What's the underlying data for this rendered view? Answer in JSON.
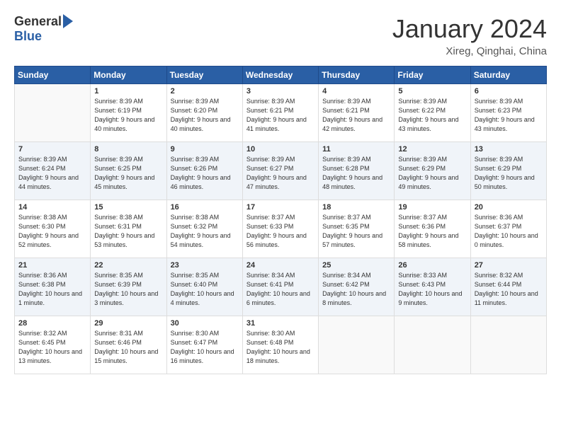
{
  "logo": {
    "general": "General",
    "blue": "Blue"
  },
  "title": "January 2024",
  "subtitle": "Xireg, Qinghai, China",
  "headers": [
    "Sunday",
    "Monday",
    "Tuesday",
    "Wednesday",
    "Thursday",
    "Friday",
    "Saturday"
  ],
  "weeks": [
    [
      {
        "num": "",
        "sunrise": "",
        "sunset": "",
        "daylight": ""
      },
      {
        "num": "1",
        "sunrise": "Sunrise: 8:39 AM",
        "sunset": "Sunset: 6:19 PM",
        "daylight": "Daylight: 9 hours and 40 minutes."
      },
      {
        "num": "2",
        "sunrise": "Sunrise: 8:39 AM",
        "sunset": "Sunset: 6:20 PM",
        "daylight": "Daylight: 9 hours and 40 minutes."
      },
      {
        "num": "3",
        "sunrise": "Sunrise: 8:39 AM",
        "sunset": "Sunset: 6:21 PM",
        "daylight": "Daylight: 9 hours and 41 minutes."
      },
      {
        "num": "4",
        "sunrise": "Sunrise: 8:39 AM",
        "sunset": "Sunset: 6:21 PM",
        "daylight": "Daylight: 9 hours and 42 minutes."
      },
      {
        "num": "5",
        "sunrise": "Sunrise: 8:39 AM",
        "sunset": "Sunset: 6:22 PM",
        "daylight": "Daylight: 9 hours and 43 minutes."
      },
      {
        "num": "6",
        "sunrise": "Sunrise: 8:39 AM",
        "sunset": "Sunset: 6:23 PM",
        "daylight": "Daylight: 9 hours and 43 minutes."
      }
    ],
    [
      {
        "num": "7",
        "sunrise": "Sunrise: 8:39 AM",
        "sunset": "Sunset: 6:24 PM",
        "daylight": "Daylight: 9 hours and 44 minutes."
      },
      {
        "num": "8",
        "sunrise": "Sunrise: 8:39 AM",
        "sunset": "Sunset: 6:25 PM",
        "daylight": "Daylight: 9 hours and 45 minutes."
      },
      {
        "num": "9",
        "sunrise": "Sunrise: 8:39 AM",
        "sunset": "Sunset: 6:26 PM",
        "daylight": "Daylight: 9 hours and 46 minutes."
      },
      {
        "num": "10",
        "sunrise": "Sunrise: 8:39 AM",
        "sunset": "Sunset: 6:27 PM",
        "daylight": "Daylight: 9 hours and 47 minutes."
      },
      {
        "num": "11",
        "sunrise": "Sunrise: 8:39 AM",
        "sunset": "Sunset: 6:28 PM",
        "daylight": "Daylight: 9 hours and 48 minutes."
      },
      {
        "num": "12",
        "sunrise": "Sunrise: 8:39 AM",
        "sunset": "Sunset: 6:29 PM",
        "daylight": "Daylight: 9 hours and 49 minutes."
      },
      {
        "num": "13",
        "sunrise": "Sunrise: 8:39 AM",
        "sunset": "Sunset: 6:29 PM",
        "daylight": "Daylight: 9 hours and 50 minutes."
      }
    ],
    [
      {
        "num": "14",
        "sunrise": "Sunrise: 8:38 AM",
        "sunset": "Sunset: 6:30 PM",
        "daylight": "Daylight: 9 hours and 52 minutes."
      },
      {
        "num": "15",
        "sunrise": "Sunrise: 8:38 AM",
        "sunset": "Sunset: 6:31 PM",
        "daylight": "Daylight: 9 hours and 53 minutes."
      },
      {
        "num": "16",
        "sunrise": "Sunrise: 8:38 AM",
        "sunset": "Sunset: 6:32 PM",
        "daylight": "Daylight: 9 hours and 54 minutes."
      },
      {
        "num": "17",
        "sunrise": "Sunrise: 8:37 AM",
        "sunset": "Sunset: 6:33 PM",
        "daylight": "Daylight: 9 hours and 56 minutes."
      },
      {
        "num": "18",
        "sunrise": "Sunrise: 8:37 AM",
        "sunset": "Sunset: 6:35 PM",
        "daylight": "Daylight: 9 hours and 57 minutes."
      },
      {
        "num": "19",
        "sunrise": "Sunrise: 8:37 AM",
        "sunset": "Sunset: 6:36 PM",
        "daylight": "Daylight: 9 hours and 58 minutes."
      },
      {
        "num": "20",
        "sunrise": "Sunrise: 8:36 AM",
        "sunset": "Sunset: 6:37 PM",
        "daylight": "Daylight: 10 hours and 0 minutes."
      }
    ],
    [
      {
        "num": "21",
        "sunrise": "Sunrise: 8:36 AM",
        "sunset": "Sunset: 6:38 PM",
        "daylight": "Daylight: 10 hours and 1 minute."
      },
      {
        "num": "22",
        "sunrise": "Sunrise: 8:35 AM",
        "sunset": "Sunset: 6:39 PM",
        "daylight": "Daylight: 10 hours and 3 minutes."
      },
      {
        "num": "23",
        "sunrise": "Sunrise: 8:35 AM",
        "sunset": "Sunset: 6:40 PM",
        "daylight": "Daylight: 10 hours and 4 minutes."
      },
      {
        "num": "24",
        "sunrise": "Sunrise: 8:34 AM",
        "sunset": "Sunset: 6:41 PM",
        "daylight": "Daylight: 10 hours and 6 minutes."
      },
      {
        "num": "25",
        "sunrise": "Sunrise: 8:34 AM",
        "sunset": "Sunset: 6:42 PM",
        "daylight": "Daylight: 10 hours and 8 minutes."
      },
      {
        "num": "26",
        "sunrise": "Sunrise: 8:33 AM",
        "sunset": "Sunset: 6:43 PM",
        "daylight": "Daylight: 10 hours and 9 minutes."
      },
      {
        "num": "27",
        "sunrise": "Sunrise: 8:32 AM",
        "sunset": "Sunset: 6:44 PM",
        "daylight": "Daylight: 10 hours and 11 minutes."
      }
    ],
    [
      {
        "num": "28",
        "sunrise": "Sunrise: 8:32 AM",
        "sunset": "Sunset: 6:45 PM",
        "daylight": "Daylight: 10 hours and 13 minutes."
      },
      {
        "num": "29",
        "sunrise": "Sunrise: 8:31 AM",
        "sunset": "Sunset: 6:46 PM",
        "daylight": "Daylight: 10 hours and 15 minutes."
      },
      {
        "num": "30",
        "sunrise": "Sunrise: 8:30 AM",
        "sunset": "Sunset: 6:47 PM",
        "daylight": "Daylight: 10 hours and 16 minutes."
      },
      {
        "num": "31",
        "sunrise": "Sunrise: 8:30 AM",
        "sunset": "Sunset: 6:48 PM",
        "daylight": "Daylight: 10 hours and 18 minutes."
      },
      {
        "num": "",
        "sunrise": "",
        "sunset": "",
        "daylight": ""
      },
      {
        "num": "",
        "sunrise": "",
        "sunset": "",
        "daylight": ""
      },
      {
        "num": "",
        "sunrise": "",
        "sunset": "",
        "daylight": ""
      }
    ]
  ]
}
